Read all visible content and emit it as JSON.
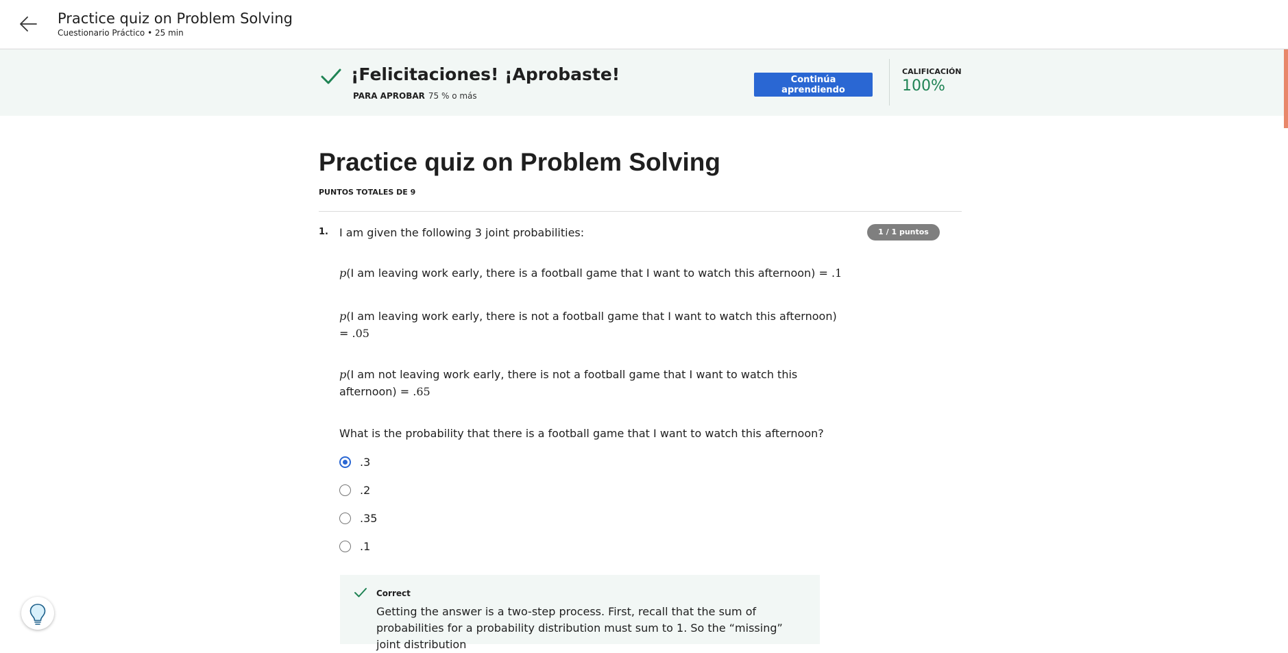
{
  "header": {
    "title": "Practice quiz on Problem Solving",
    "subtitle": "Cuestionario Práctico • 25 min"
  },
  "banner": {
    "message": "¡Felicitaciones! ¡Aprobaste!",
    "pass_label": "PARA APROBAR",
    "pass_value": "75 % o más",
    "continue_label": "Continúa aprendiendo",
    "grade_label": "CALIFICACIÓN",
    "grade_value": "100%"
  },
  "quiz": {
    "title": "Practice quiz on Problem Solving",
    "total_points": "PUNTOS TOTALES DE 9",
    "question": {
      "number": "1.",
      "points": "1 / 1 puntos",
      "intro": "I am given the following 3 joint probabilities:",
      "p_symbol": "p",
      "probs": [
        {
          "text": "(I am leaving work early, there is a football game that I want to watch this afternoon) = ",
          "value": ".1"
        },
        {
          "text": "(I am leaving work early, there is not a football game that I want to watch this afternoon) = ",
          "value": ".05"
        },
        {
          "text": "(I am not leaving work early, there is not a football game that I want to watch this afternoon) = ",
          "value": ".65"
        }
      ],
      "prompt": "What is the probability that there is a football game that I want to watch this afternoon?",
      "options": [
        ".3",
        ".2",
        ".35",
        ".1"
      ],
      "selected_index": 0,
      "feedback": {
        "label": "Correct",
        "text": "Getting the answer is a two-step process. First, recall that the sum of probabilities for a probability distribution must sum to 1. So the “missing” joint distribution"
      }
    }
  },
  "colors": {
    "accent": "#2a67d3",
    "success": "#1f8354",
    "banner_bg": "#f2f7f5",
    "pill_bg": "#7f7f7f"
  },
  "icons": [
    "back-arrow-icon",
    "check-icon",
    "lightbulb-icon"
  ]
}
